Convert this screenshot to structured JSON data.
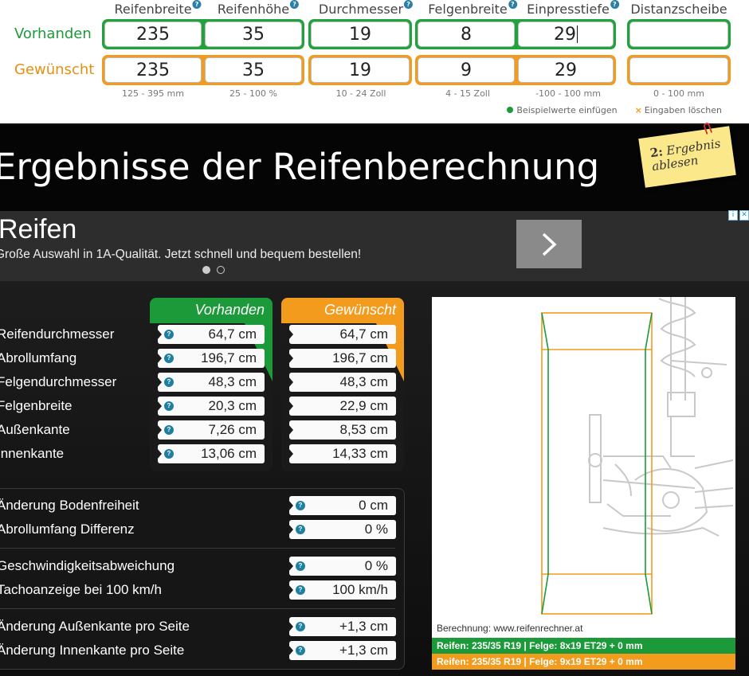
{
  "form": {
    "columns": {
      "reifenbreite": "Reifenbreite",
      "reifenhoehe": "Reifenhöhe",
      "durchmesser": "Durchmesser",
      "felgenbreite": "Felgenbreite",
      "einpresstiefe": "Einpresstiefe",
      "distanzscheibe": "Distanzscheibe"
    },
    "help_glyph": "?",
    "rows": {
      "vorhanden": {
        "label": "Vorhanden",
        "reifenbreite": "235",
        "reifenhoehe": "35",
        "durchmesser": "19",
        "felgenbreite": "8",
        "einpresstiefe": "29",
        "distanzscheibe": ""
      },
      "gewuenscht": {
        "label": "Gewünscht",
        "reifenbreite": "235",
        "reifenhoehe": "35",
        "durchmesser": "19",
        "felgenbreite": "9",
        "einpresstiefe": "29",
        "distanzscheibe": ""
      }
    },
    "ranges": {
      "reifenbreite": "125 - 395 mm",
      "reifenhoehe": "25 - 100 %",
      "durchmesser": "10 - 24 Zoll",
      "felgenbreite": "4 - 15 Zoll",
      "einpresstiefe": "-100 - 100 mm",
      "distanzscheibe": "0 - 100 mm"
    },
    "links": {
      "example": "Beispielwerte einfügen",
      "clear": "Eingaben löschen",
      "clear_glyph": "×"
    }
  },
  "heading": {
    "title": "Ergebnisse der Reifenberechnung",
    "sticky_num": "2:",
    "sticky_text1": "Ergebnis",
    "sticky_text2": "ablesen"
  },
  "ad": {
    "title": "Reifen",
    "description": "Große Auswahl in 1A-Qualität. Jetzt schnell und bequem bestellen!",
    "arrow_glyph": "›",
    "adchoice_i": "i",
    "adchoice_x": "✕"
  },
  "results": {
    "header_vorhanden": "Vorhanden",
    "header_gewuenscht": "Gewünscht",
    "rows": [
      {
        "label": "Reifendurchmesser",
        "vorhanden": "64,7 cm",
        "gewuenscht": "64,7 cm"
      },
      {
        "label": "Abrollumfang",
        "vorhanden": "196,7 cm",
        "gewuenscht": "196,7 cm"
      },
      {
        "label": "Felgendurchmesser",
        "vorhanden": "48,3 cm",
        "gewuenscht": "48,3 cm"
      },
      {
        "label": "Felgenbreite",
        "vorhanden": "20,3 cm",
        "gewuenscht": "22,9 cm"
      },
      {
        "label": "Außenkante",
        "vorhanden": "7,26 cm",
        "gewuenscht": "8,53 cm"
      },
      {
        "label": "Innenkante",
        "vorhanden": "13,06 cm",
        "gewuenscht": "14,33 cm"
      }
    ],
    "diff": [
      {
        "label": "Änderung Bodenfreiheit",
        "value": "0 cm"
      },
      {
        "label": "Abrollumfang Differenz",
        "value": "0 %"
      },
      {
        "label": "Geschwindigkeitsabweichung",
        "value": "0 %"
      },
      {
        "label": "Tachoanzeige bei 100 km/h",
        "value": "100 km/h"
      },
      {
        "label": "Änderung Außenkante pro Seite",
        "value": "+1,3 cm"
      },
      {
        "label": "Änderung Innenkante pro Seite",
        "value": "+1,3 cm"
      }
    ]
  },
  "diagram": {
    "caption": "Berechnung: www.reifenrechner.at",
    "bar_vorhanden": "Reifen: 235/35 R19  |  Felge: 8x19 ET29 + 0 mm",
    "bar_gewuenscht": "Reifen: 235/35 R19  |  Felge: 9x19 ET29 + 0 mm"
  },
  "colors": {
    "green": "#1c9a3a",
    "orange": "#f39b1d",
    "help_blue": "#1f7fa0"
  }
}
